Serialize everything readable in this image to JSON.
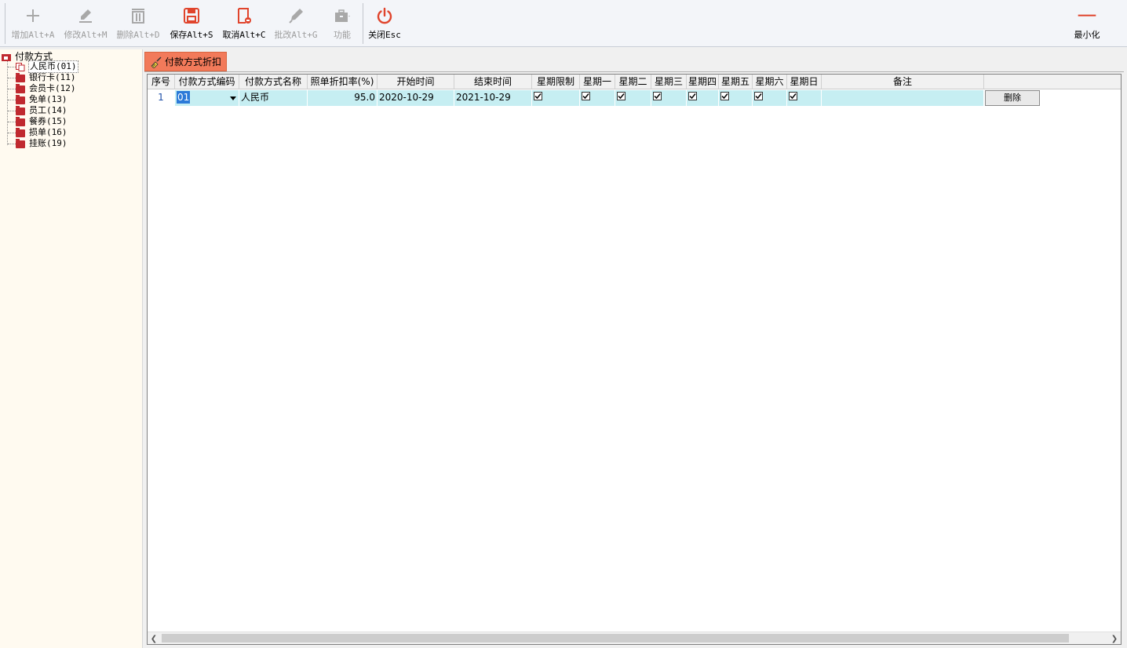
{
  "toolbar": {
    "buttons": [
      {
        "label": "增加Alt+A",
        "icon": "plus-icon",
        "enabled": false
      },
      {
        "label": "修改Alt+M",
        "icon": "pencil-icon",
        "enabled": false
      },
      {
        "label": "删除Alt+D",
        "icon": "trash-icon",
        "enabled": false
      },
      {
        "label": "保存Alt+S",
        "icon": "save-icon",
        "enabled": true
      },
      {
        "label": "取消Alt+C",
        "icon": "cancel-doc-icon",
        "enabled": true
      },
      {
        "label": "批改Alt+G",
        "icon": "pen-icon",
        "enabled": false
      },
      {
        "label": "功能",
        "icon": "toolbox-icon",
        "enabled": false
      },
      {
        "label": "关闭Esc",
        "icon": "power-icon",
        "enabled": true
      }
    ],
    "minimize_label": "最小化",
    "accent_color": "#e0442c"
  },
  "tree": {
    "root": "付款方式",
    "items": [
      {
        "label": "人民币(01)",
        "selected": true
      },
      {
        "label": "银行卡(11)"
      },
      {
        "label": "会员卡(12)"
      },
      {
        "label": "免单(13)"
      },
      {
        "label": "员工(14)"
      },
      {
        "label": "餐券(15)"
      },
      {
        "label": "损单(16)"
      },
      {
        "label": "挂账(19)"
      }
    ]
  },
  "tab": {
    "label": "付款方式折扣",
    "icon": "broom-icon"
  },
  "grid": {
    "columns": [
      "序号",
      "付款方式编码",
      "付款方式名称",
      "照单折扣率(%)",
      "开始时间",
      "结束时间",
      "星期限制",
      "星期一",
      "星期二",
      "星期三",
      "星期四",
      "星期五",
      "星期六",
      "星期日",
      "备注"
    ],
    "rows": [
      {
        "seq": "1",
        "code": "01",
        "name": "人民币",
        "discount": "95.0",
        "start": "2020-10-29",
        "end": "2021-10-29",
        "checks": [
          true,
          true,
          true,
          true,
          true,
          true,
          true,
          true
        ],
        "note": "",
        "delete_label": "删除"
      }
    ]
  }
}
